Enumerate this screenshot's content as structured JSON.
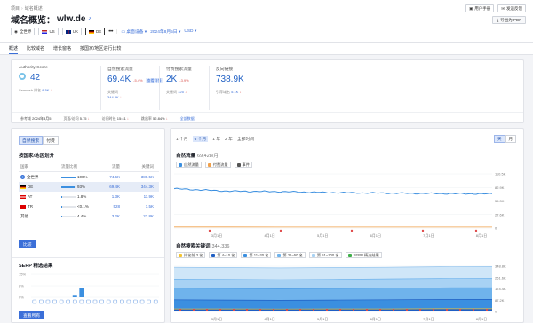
{
  "header": {
    "breadcrumbs": [
      "项目",
      "域名概述"
    ],
    "title_prefix": "域名概览：",
    "domain": "wlw.de",
    "buttons": {
      "manual": "用户手册",
      "feedback": "发送反馈",
      "pdf": "导出为 PDF"
    },
    "filters": {
      "scopes": [
        {
          "label": "全世界",
          "flag": "globe"
        },
        {
          "label": "US",
          "flag": "us"
        },
        {
          "label": "UK",
          "flag": "uk"
        },
        {
          "label": "DE",
          "flag": "de",
          "active": true
        }
      ],
      "more": "•••",
      "device": "桌面设备",
      "date": "2024年8月5日",
      "currency": "USD"
    }
  },
  "tabs": [
    "概述",
    "比较域名",
    "增长窗格",
    "按国家/地区进行比较"
  ],
  "metrics": {
    "authority": {
      "label": "Authority Score",
      "value": "42",
      "sub_label": "Semrush 排名",
      "sub_value": "8.5K",
      "sub_trend": "↓"
    },
    "organic": {
      "label": "自然搜索流量",
      "value": "69.4K",
      "pct": "-5.4%",
      "badge": "查看详情",
      "kw_label": "关键词",
      "kw_value": "344.3K"
    },
    "paid": {
      "label": "付费搜索流量",
      "value": "2K",
      "pct": "-3.9%",
      "kw_label": "关键词",
      "kw_value": "125"
    },
    "backlinks": {
      "label": "反向链接",
      "value": "738.9K",
      "sub_label": "引荐域名",
      "sub_value": "5.1K"
    },
    "footer": [
      {
        "label": "参考域",
        "value": "2024年8月5"
      },
      {
        "label": "页面/访问",
        "value": "5.75"
      },
      {
        "label": "访问时长",
        "value": "15:41"
      },
      {
        "label": "跳出率",
        "value": "52.84%"
      },
      {
        "label": "",
        "value": "",
        "link": "全部数据"
      }
    ]
  },
  "left": {
    "segment": [
      "自然搜索",
      "付费"
    ],
    "dist_title": "按国家/地区划分",
    "table_headers": [
      "国家",
      "流量比例",
      "流量",
      "关键词"
    ],
    "rows": [
      {
        "country": "全世界",
        "flag": "globe",
        "share": "100%",
        "share_frac": 1.0,
        "traffic": "74.6K",
        "keywords": "380.5K"
      },
      {
        "country": "DE",
        "flag": "de",
        "share": "93%",
        "share_frac": 0.93,
        "traffic": "69.4K",
        "keywords": "344.3K",
        "selected": true
      },
      {
        "country": "AT",
        "flag": "at",
        "share": "1.8%",
        "share_frac": 0.05,
        "traffic": "1.3K",
        "keywords": "11.9K"
      },
      {
        "country": "TR",
        "flag": "tr",
        "share": "<0.1%",
        "share_frac": 0.02,
        "traffic": "528",
        "keywords": "1.5K"
      },
      {
        "country": "其他",
        "flag": "",
        "share": "4.4%",
        "share_frac": 0.06,
        "traffic": "3.2K",
        "keywords": "22.8K"
      }
    ],
    "compare_button": "比较",
    "serp_title": "SERP 精选结果",
    "serp_y_labels": [
      "15%",
      "8%",
      "0%"
    ],
    "serp_values": [
      0,
      0,
      0,
      0,
      0,
      0,
      1,
      6,
      0,
      0,
      0,
      0,
      0,
      0,
      0,
      0,
      0,
      0,
      0
    ],
    "serp_button": "查看所有"
  },
  "right": {
    "ranges": [
      "1 个月",
      "6 个月",
      "1 年",
      "2 年",
      "全部时间"
    ],
    "active_range": "6 个月",
    "units": [
      "天",
      "月"
    ],
    "active_unit": "天",
    "traffic_title": "自然流量",
    "traffic_sub": "69,428/月",
    "traffic_legend": [
      {
        "label": "自然流量",
        "color": "#3b8fe0"
      },
      {
        "label": "付费流量",
        "color": "#f0a04b"
      },
      {
        "label": "事件",
        "color": "#555555"
      }
    ],
    "kw_title": "自然搜索关键词",
    "kw_sub": "344,336",
    "kw_legend": [
      {
        "label": "排名前 3 名",
        "color": "#f4c430"
      },
      {
        "label": "第 4–10 名",
        "color": "#1f5fc4"
      },
      {
        "label": "第 11–20 名",
        "color": "#3b8fe0"
      },
      {
        "label": "第 21–50 名",
        "color": "#6fb3ec"
      },
      {
        "label": "第 51–100 名",
        "color": "#a8d2f4"
      },
      {
        "label": "SERP 精选结果",
        "color": "#3fae49"
      }
    ]
  },
  "chart_data": [
    {
      "type": "line",
      "title": "自然流量",
      "x": [
        "3月1日",
        "4月1日",
        "5月1日",
        "6月1日",
        "7月1日",
        "8月1日"
      ],
      "ylim": [
        0,
        110000
      ],
      "y_ticks": [
        "110.5K",
        "82.9K",
        "55.3K",
        "27.6K",
        "0"
      ],
      "series": [
        {
          "name": "自然流量",
          "values": [
            80000,
            75000,
            74000,
            72000,
            71000,
            70000,
            69400
          ]
        },
        {
          "name": "付费流量",
          "values": [
            2200,
            2100,
            2000,
            2000,
            2000,
            2000,
            2000
          ]
        }
      ]
    },
    {
      "type": "area",
      "title": "自然搜索关键词",
      "x": [
        "3月1日",
        "4月1日",
        "5月1日",
        "6月1日",
        "7月1日",
        "8月1日"
      ],
      "ylim": [
        0,
        348000
      ],
      "y_ticks": [
        "348.8K",
        "261.6K",
        "174.4K",
        "87.2K",
        "0"
      ],
      "series": [
        {
          "name": "第 51–100 名",
          "values": [
            340000,
            338000,
            335000,
            338000,
            340000,
            344000,
            344336
          ]
        },
        {
          "name": "第 21–50 名",
          "values": [
            250000,
            248000,
            245000,
            248000,
            252000,
            255000,
            256000
          ]
        },
        {
          "name": "第 11–20 名",
          "values": [
            180000,
            178000,
            176000,
            178000,
            180000,
            182000,
            183000
          ]
        },
        {
          "name": "第 4–10 名",
          "values": [
            90000,
            88000,
            86000,
            88000,
            90000,
            92000,
            93000
          ]
        },
        {
          "name": "排名前 3 名",
          "values": [
            20000,
            20000,
            19000,
            20000,
            20000,
            21000,
            21000
          ]
        }
      ]
    }
  ]
}
